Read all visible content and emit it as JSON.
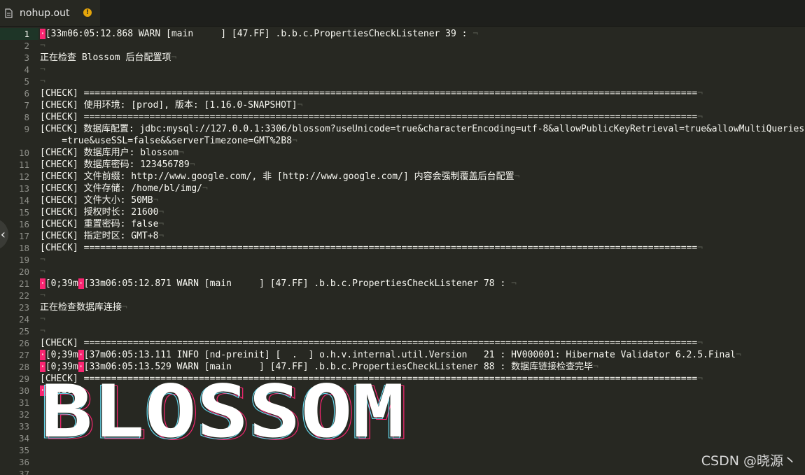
{
  "tab": {
    "filename": "nohup.out",
    "modified_glyph": "!"
  },
  "lines": [
    {
      "n": "1",
      "segs": [
        {
          "t": "·",
          "c": "esc"
        },
        {
          "t": "[33m06:05:12.868 WARN [main     ] [47.FF] .b.b.c.PropertiesCheckListener 39 : "
        },
        {
          "t": "¬",
          "c": "ws"
        }
      ]
    },
    {
      "n": "2",
      "segs": [
        {
          "t": "¬",
          "c": "ws"
        }
      ]
    },
    {
      "n": "3",
      "segs": [
        {
          "t": "正在检查 Blossom 后台配置项"
        },
        {
          "t": "¬",
          "c": "ws"
        }
      ]
    },
    {
      "n": "4",
      "segs": [
        {
          "t": "¬",
          "c": "ws"
        }
      ]
    },
    {
      "n": "5",
      "segs": [
        {
          "t": "¬",
          "c": "ws"
        }
      ]
    },
    {
      "n": "6",
      "segs": [
        {
          "t": "[CHECK] ================================================================================================================"
        },
        {
          "t": "¬",
          "c": "ws"
        }
      ]
    },
    {
      "n": "7",
      "segs": [
        {
          "t": "[CHECK] 使用环境: [prod], 版本: [1.16.0-SNAPSHOT]"
        },
        {
          "t": "¬",
          "c": "ws"
        }
      ]
    },
    {
      "n": "8",
      "segs": [
        {
          "t": "[CHECK] ================================================================================================================"
        },
        {
          "t": "¬",
          "c": "ws"
        }
      ]
    },
    {
      "n": "9",
      "segs": [
        {
          "t": "[CHECK] 数据库配置: jdbc:mysql://127.0.0.1:3306/blossom?useUnicode=true&characterEncoding=utf-8&allowPublicKeyRetrieval=true&allowMultiQueries"
        }
      ]
    },
    {
      "n": "",
      "segs": [
        {
          "t": "    =true&useSSL=false&&serverTimezone=GMT%2B8"
        },
        {
          "t": "¬",
          "c": "ws"
        }
      ]
    },
    {
      "n": "10",
      "segs": [
        {
          "t": "[CHECK] 数据库用户: blossom"
        },
        {
          "t": "¬",
          "c": "ws"
        }
      ]
    },
    {
      "n": "11",
      "segs": [
        {
          "t": "[CHECK] 数据库密码: 123456789"
        },
        {
          "t": "¬",
          "c": "ws"
        }
      ]
    },
    {
      "n": "12",
      "segs": [
        {
          "t": "[CHECK] 文件前缀: http://www.google.com/, 非 [http://www.google.com/] 内容会强制覆盖后台配置"
        },
        {
          "t": "¬",
          "c": "ws"
        }
      ]
    },
    {
      "n": "13",
      "segs": [
        {
          "t": "[CHECK] 文件存储: /home/bl/img/"
        },
        {
          "t": "¬",
          "c": "ws"
        }
      ]
    },
    {
      "n": "14",
      "segs": [
        {
          "t": "[CHECK] 文件大小: 50MB"
        },
        {
          "t": "¬",
          "c": "ws"
        }
      ]
    },
    {
      "n": "15",
      "segs": [
        {
          "t": "[CHECK] 授权时长: 21600"
        },
        {
          "t": "¬",
          "c": "ws"
        }
      ]
    },
    {
      "n": "16",
      "segs": [
        {
          "t": "[CHECK] 重置密码: false"
        },
        {
          "t": "¬",
          "c": "ws"
        }
      ]
    },
    {
      "n": "17",
      "segs": [
        {
          "t": "[CHECK] 指定时区: GMT+8"
        },
        {
          "t": "¬",
          "c": "ws"
        }
      ]
    },
    {
      "n": "18",
      "segs": [
        {
          "t": "[CHECK] ================================================================================================================"
        },
        {
          "t": "¬",
          "c": "ws"
        }
      ]
    },
    {
      "n": "19",
      "segs": [
        {
          "t": "¬",
          "c": "ws"
        }
      ]
    },
    {
      "n": "20",
      "segs": [
        {
          "t": "¬",
          "c": "ws"
        }
      ]
    },
    {
      "n": "21",
      "segs": [
        {
          "t": "·",
          "c": "esc"
        },
        {
          "t": "[0;39m"
        },
        {
          "t": "·",
          "c": "esc"
        },
        {
          "t": "[33m06:05:12.871 WARN [main     ] [47.FF] .b.b.c.PropertiesCheckListener 78 : "
        },
        {
          "t": "¬",
          "c": "ws"
        }
      ]
    },
    {
      "n": "22",
      "segs": [
        {
          "t": "¬",
          "c": "ws"
        }
      ]
    },
    {
      "n": "23",
      "segs": [
        {
          "t": "正在检查数据库连接"
        },
        {
          "t": "¬",
          "c": "ws"
        }
      ]
    },
    {
      "n": "24",
      "segs": [
        {
          "t": "¬",
          "c": "ws"
        }
      ]
    },
    {
      "n": "25",
      "segs": [
        {
          "t": "¬",
          "c": "ws"
        }
      ]
    },
    {
      "n": "26",
      "segs": [
        {
          "t": "[CHECK] ================================================================================================================"
        },
        {
          "t": "¬",
          "c": "ws"
        }
      ]
    },
    {
      "n": "27",
      "segs": [
        {
          "t": "·",
          "c": "esc"
        },
        {
          "t": "[0;39m"
        },
        {
          "t": "·",
          "c": "esc"
        },
        {
          "t": "[37m06:05:13.111 INFO [nd-preinit] [  .  ] o.h.v.internal.util.Version   21 : HV000001: Hibernate Validator 6.2.5.Final"
        },
        {
          "t": "¬",
          "c": "ws"
        }
      ]
    },
    {
      "n": "28",
      "segs": [
        {
          "t": "·",
          "c": "esc"
        },
        {
          "t": "[0;39m"
        },
        {
          "t": "·",
          "c": "esc"
        },
        {
          "t": "[33m06:05:13.529 WARN [main     ] [47.FF] .b.b.c.PropertiesCheckListener 88 : 数据库链接检查完毕"
        },
        {
          "t": "¬",
          "c": "ws"
        }
      ]
    },
    {
      "n": "29",
      "segs": [
        {
          "t": "[CHECK] ================================================================================================================"
        },
        {
          "t": "¬",
          "c": "ws"
        }
      ]
    },
    {
      "n": "30",
      "segs": [
        {
          "t": "·",
          "c": "esc"
        },
        {
          "t": "[0;39m"
        },
        {
          "t": "¬",
          "c": "ws"
        }
      ]
    },
    {
      "n": "31",
      "segs": []
    },
    {
      "n": "32",
      "segs": []
    },
    {
      "n": "33",
      "segs": []
    },
    {
      "n": "34",
      "segs": []
    },
    {
      "n": "35",
      "segs": []
    },
    {
      "n": "36",
      "segs": []
    },
    {
      "n": "37",
      "segs": []
    }
  ],
  "logo_text": "BLOSSOM",
  "watermark": "CSDN @晓源丶",
  "colors": {
    "background": "#272822",
    "escape_marker": "#f92672",
    "gutter_active": "#1e3527"
  }
}
